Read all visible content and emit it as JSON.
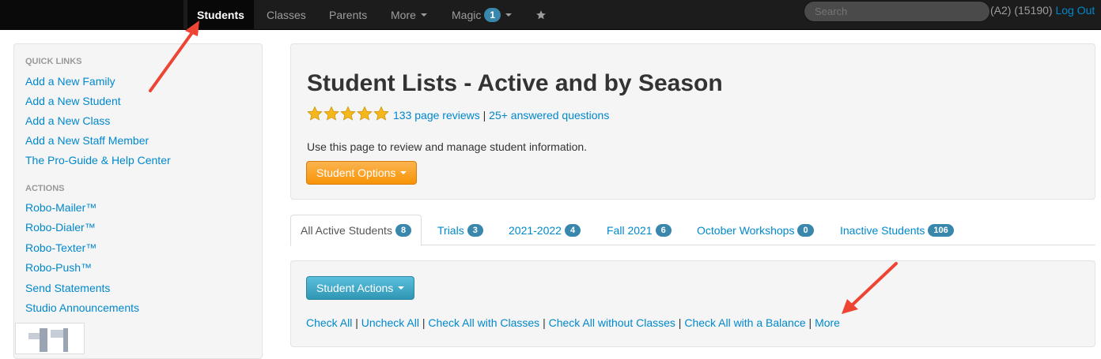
{
  "navbar": {
    "items": [
      {
        "label": "Students",
        "active": true
      },
      {
        "label": "Classes"
      },
      {
        "label": "Parents"
      },
      {
        "label": "More"
      },
      {
        "label": "Magic",
        "badge": "1"
      }
    ],
    "star_icon": "star-icon",
    "search_placeholder": "Search",
    "user_info": "(A2) (15190)",
    "logout_label": "Log Out"
  },
  "sidebar": {
    "quick_links_header": "QUICK LINKS",
    "quick_links": [
      "Add a New Family",
      "Add a New Student",
      "Add a New Class",
      "Add a New Staff Member",
      "The Pro-Guide & Help Center"
    ],
    "actions_header": "ACTIONS",
    "actions": [
      "Robo-Mailer™",
      "Robo-Dialer™",
      "Robo-Texter™",
      "Robo-Push™",
      "Send Statements",
      "Studio Announcements"
    ]
  },
  "hero": {
    "title": "Student Lists - Active and by Season",
    "rating_stars": 5,
    "reviews_link": "133 page reviews",
    "separator": "|",
    "questions_link": "25+ answered questions",
    "intro": "Use this page to review and manage student information.",
    "options_button": "Student Options"
  },
  "tabs": [
    {
      "label": "All Active Students",
      "count": "8",
      "active": true
    },
    {
      "label": "Trials",
      "count": "3"
    },
    {
      "label": "2021-2022",
      "count": "4"
    },
    {
      "label": "Fall 2021",
      "count": "6"
    },
    {
      "label": "October Workshops",
      "count": "0"
    },
    {
      "label": "Inactive Students",
      "count": "106"
    }
  ],
  "panel": {
    "actions_button": "Student Actions",
    "check_links": [
      "Check All",
      "Uncheck All",
      "Check All with Classes",
      "Check All without Classes",
      "Check All with a Balance",
      "More"
    ]
  },
  "colors": {
    "navbar": "#1c1c1c",
    "link": "#0088cc",
    "badge": "#3a87ad",
    "orange_button": "#f89406",
    "blue_button": "#2f96b4",
    "annotation_arrow": "#ee4433",
    "star": "#f5b81c"
  }
}
